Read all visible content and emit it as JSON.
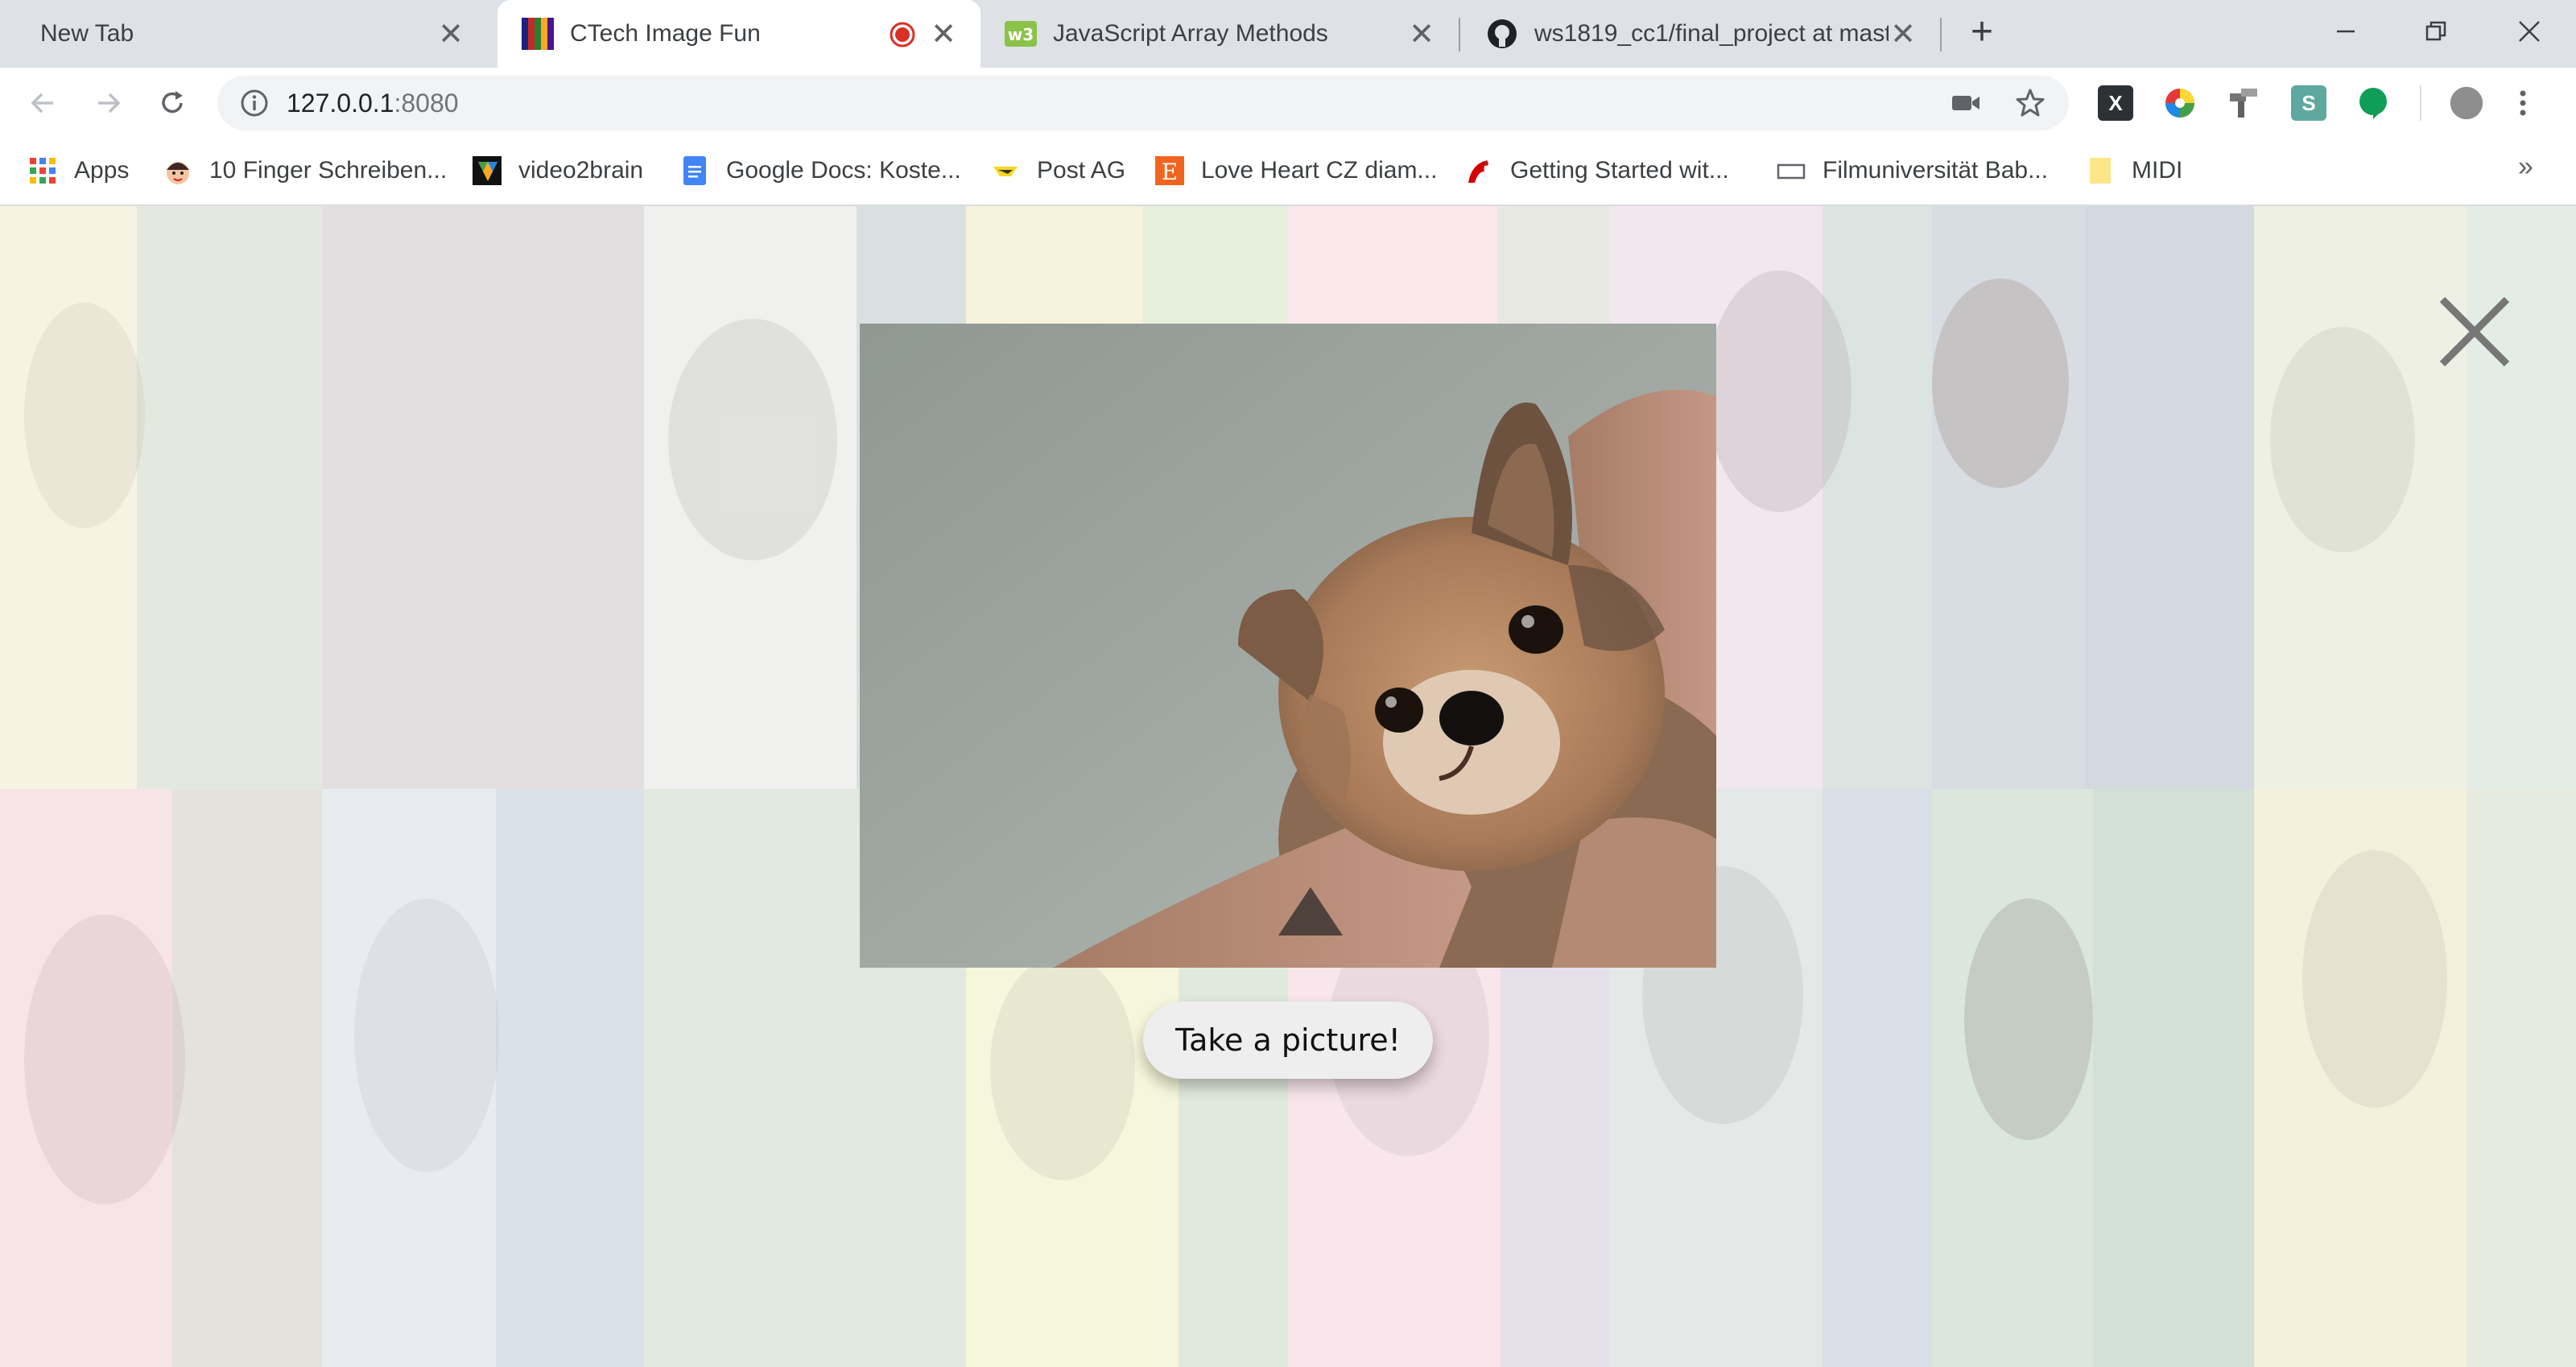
{
  "browser": {
    "tabs": [
      {
        "title": "New Tab",
        "favicon": "none",
        "active": false
      },
      {
        "title": "CTech Image Fun",
        "favicon": "color-stripes-icon",
        "active": true,
        "recording": true
      },
      {
        "title": "JavaScript Array Methods",
        "favicon": "w3schools-icon",
        "active": false
      },
      {
        "title": "ws1819_cc1/final_project at mast",
        "favicon": "github-icon",
        "active": false
      }
    ],
    "address": {
      "host": "127.0.0.1",
      "port": ":8080"
    },
    "bookmarks": [
      {
        "label": "Apps",
        "icon": "apps-grid-icon"
      },
      {
        "label": "10 Finger Schreiben...",
        "icon": "avatar-icon"
      },
      {
        "label": "video2brain",
        "icon": "video2brain-icon"
      },
      {
        "label": "Google Docs: Koste...",
        "icon": "google-docs-icon"
      },
      {
        "label": "Post AG",
        "icon": "post-ag-icon"
      },
      {
        "label": "Love Heart CZ diam...",
        "icon": "etsy-icon"
      },
      {
        "label": "Getting Started wit...",
        "icon": "red-logo-icon"
      },
      {
        "label": "Filmuniversität Bab...",
        "icon": "rectangle-icon"
      },
      {
        "label": "MIDI",
        "icon": "folder-icon"
      }
    ],
    "extensions": [
      "x-extension-icon",
      "color-wheel-icon",
      "pages-icon",
      "s-extension-icon",
      "green-chat-icon",
      "profile-icon",
      "more-vert-icon"
    ]
  },
  "page": {
    "take_picture_label": "Take a picture!",
    "close_label": "close",
    "colors": {
      "strips": [
        "#f7f3e3",
        "#e4e9e0",
        "#e3dfe0",
        "#f0f0ee",
        "#d9e1e0",
        "#f6f2dc",
        "#e6eedc",
        "#fae8ea",
        "#f2e6ef",
        "#d8dde4",
        "#eef0e4",
        "#e4ece6"
      ]
    }
  }
}
